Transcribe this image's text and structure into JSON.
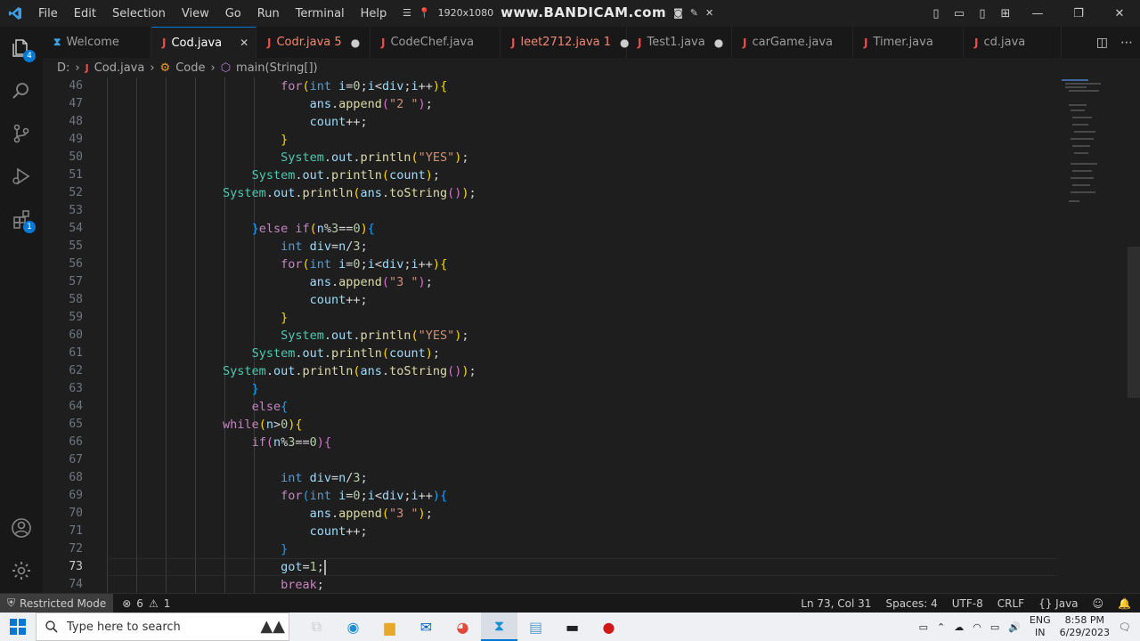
{
  "menu": [
    "File",
    "Edit",
    "Selection",
    "View",
    "Go",
    "Run",
    "Terminal",
    "Help"
  ],
  "recorder": {
    "resolution": "1920x1080",
    "brand": "www.BANDICAM.com"
  },
  "tabs": [
    {
      "label": "Welcome",
      "icon": "vscode-icon",
      "mark": ""
    },
    {
      "label": "Cod.java",
      "icon": "java-icon",
      "mark": "✕",
      "active": true
    },
    {
      "label": "Codr.java 5",
      "icon": "java-icon",
      "mark": "●",
      "error": true
    },
    {
      "label": "CodeChef.java",
      "icon": "java-icon",
      "mark": ""
    },
    {
      "label": "leet2712.java 1",
      "icon": "java-icon",
      "mark": "●",
      "error": true
    },
    {
      "label": "Test1.java",
      "icon": "java-icon",
      "mark": "●"
    },
    {
      "label": "carGame.java",
      "icon": "java-icon",
      "mark": ""
    },
    {
      "label": "Timer.java",
      "icon": "java-icon",
      "mark": ""
    },
    {
      "label": "cd.java",
      "icon": "java-icon",
      "mark": ""
    }
  ],
  "breadcrumb": {
    "drive": "D:",
    "file": "Cod.java",
    "class": "Code",
    "method": "main(String[])"
  },
  "activity_badges": {
    "explorer": "4",
    "extensions": "1"
  },
  "editor": {
    "line_numbers": [
      "46",
      "47",
      "48",
      "49",
      "50",
      "51",
      "52",
      "53",
      "54",
      "55",
      "56",
      "57",
      "58",
      "59",
      "60",
      "61",
      "62",
      "63",
      "64",
      "65",
      "66",
      "67",
      "68",
      "69",
      "70",
      "71",
      "72",
      "73",
      "74"
    ],
    "current_line": "73"
  },
  "statusbar": {
    "restricted": "Restricted Mode",
    "errors": "6",
    "warnings": "1",
    "position": "Ln 73, Col 31",
    "spaces": "Spaces: 4",
    "encoding": "UTF-8",
    "eol": "CRLF",
    "language": "Java"
  },
  "taskbar": {
    "search_placeholder": "Type here to search",
    "lang_top": "ENG",
    "lang_bottom": "IN",
    "time": "8:58 PM",
    "date": "6/29/2023"
  },
  "colors": {
    "accent": "#0078d4",
    "error": "#f14c4c",
    "editor_bg": "#1e1e1e"
  }
}
